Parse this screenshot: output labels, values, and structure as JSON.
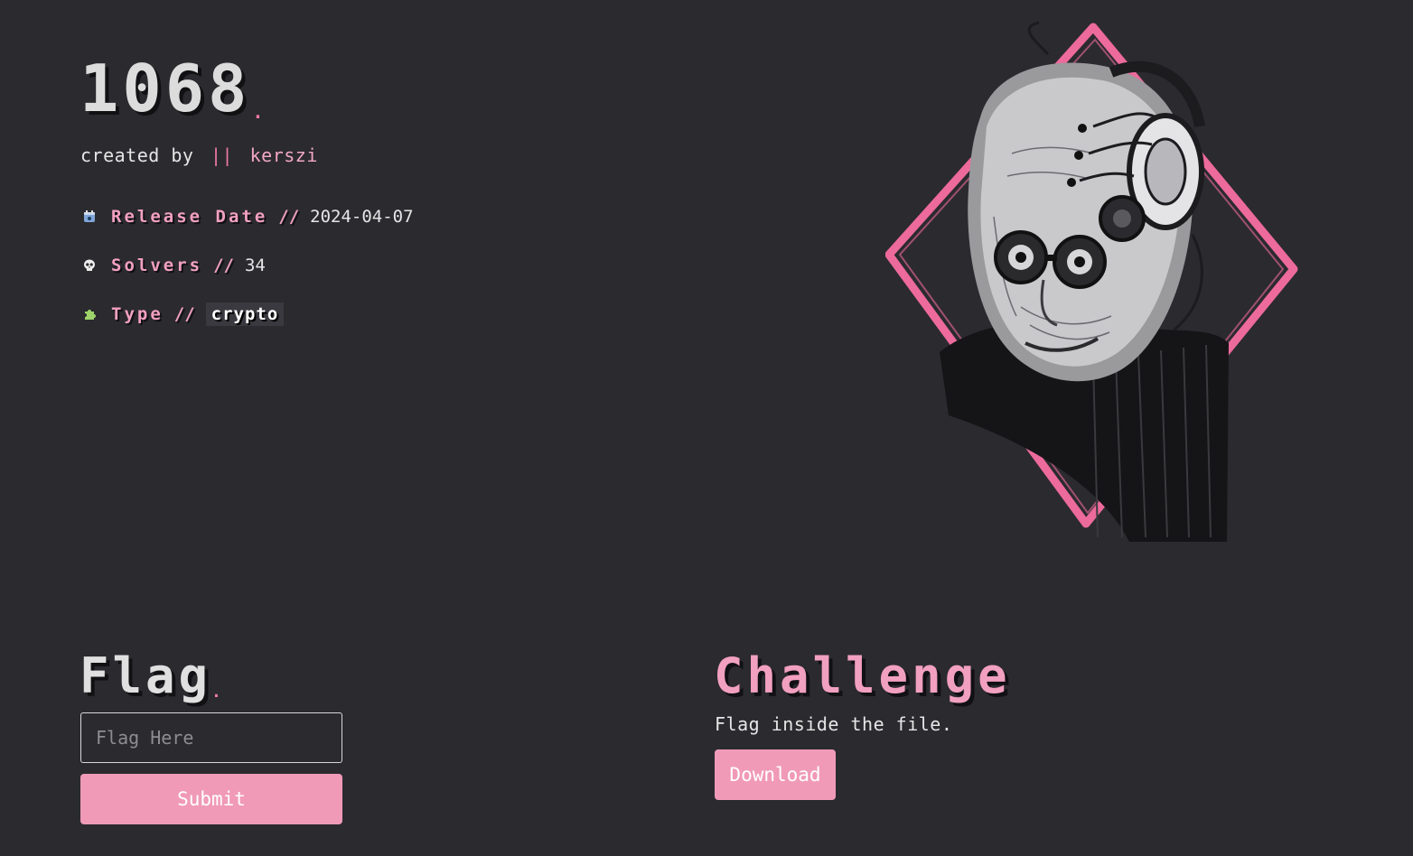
{
  "challenge": {
    "title": "1068",
    "title_dot": ".",
    "creator_prefix": "created by",
    "creator_separator": "||",
    "author": "kerszi"
  },
  "meta": {
    "release": {
      "icon": "calendar-icon",
      "label": "Release Date",
      "slash": "//",
      "value": "2024-04-07"
    },
    "solvers": {
      "icon": "skull-icon",
      "label": "Solvers",
      "slash": "//",
      "value": "34"
    },
    "type": {
      "icon": "puzzle-icon",
      "label": "Type",
      "slash": "//",
      "value": "crypto"
    }
  },
  "flag": {
    "heading": "Flag",
    "heading_dot": ".",
    "placeholder": "Flag Here",
    "submit_label": "Submit"
  },
  "challenge_section": {
    "heading": "Challenge",
    "description": "Flag inside the file.",
    "download_label": "Download"
  },
  "colors": {
    "background": "#2b2a2f",
    "accent_pink": "#f09ab8",
    "text": "#e6e6e6"
  }
}
